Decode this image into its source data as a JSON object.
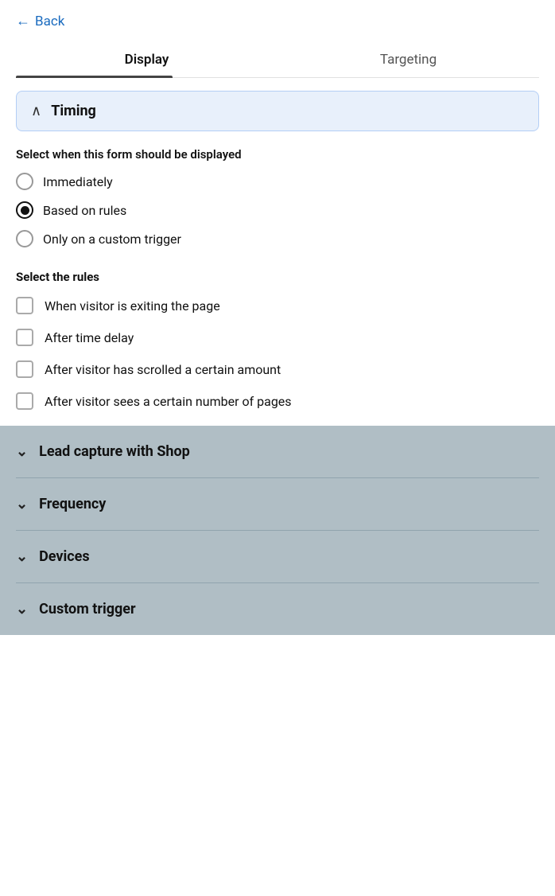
{
  "header": {
    "back_label": "Back"
  },
  "tabs": [
    {
      "id": "display",
      "label": "Display",
      "active": true
    },
    {
      "id": "targeting",
      "label": "Targeting",
      "active": false
    }
  ],
  "timing": {
    "section_title": "Timing",
    "select_when_label": "Select when this form should be displayed",
    "radio_options": [
      {
        "id": "immediately",
        "label": "Immediately",
        "checked": false
      },
      {
        "id": "based_on_rules",
        "label": "Based on rules",
        "checked": true
      },
      {
        "id": "custom_trigger",
        "label": "Only on a custom trigger",
        "checked": false
      }
    ],
    "select_rules_label": "Select the rules",
    "checkbox_options": [
      {
        "id": "exit_page",
        "label": "When visitor is exiting the page",
        "checked": false
      },
      {
        "id": "time_delay",
        "label": "After time delay",
        "checked": false
      },
      {
        "id": "scrolled",
        "label": "After visitor has scrolled a certain amount",
        "checked": false
      },
      {
        "id": "pages",
        "label": "After visitor sees a certain number of pages",
        "checked": false
      }
    ]
  },
  "collapsed_sections": [
    {
      "id": "lead_capture",
      "title": "Lead capture with Shop"
    },
    {
      "id": "frequency",
      "title": "Frequency"
    },
    {
      "id": "devices",
      "title": "Devices"
    },
    {
      "id": "custom_trigger",
      "title": "Custom trigger"
    }
  ]
}
